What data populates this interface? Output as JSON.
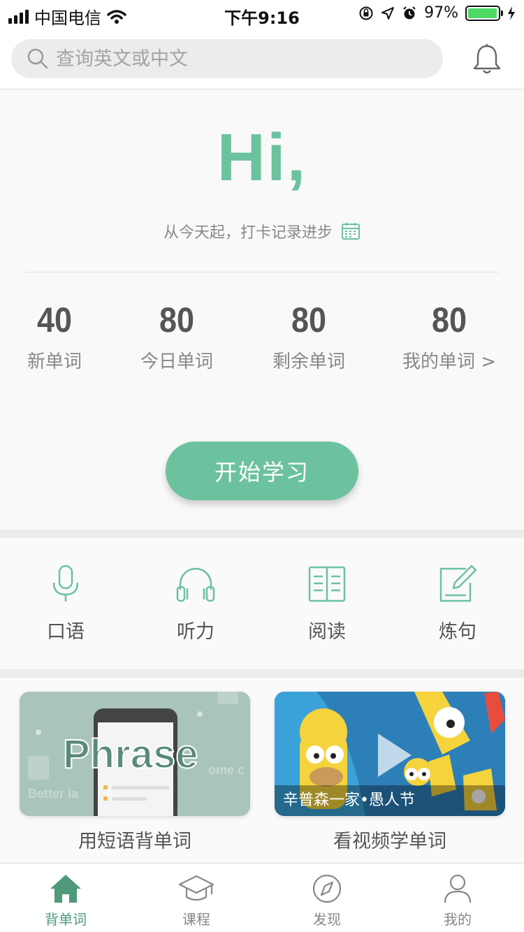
{
  "status_bar": {
    "carrier": "中国电信",
    "time": "下午9:16",
    "battery_percent": "97%",
    "battery_level": 0.97,
    "battery_color": "#4cd964"
  },
  "header": {
    "search_placeholder": "查询英文或中文",
    "bell_icon": "bell-icon"
  },
  "hero": {
    "greeting": "Hi,",
    "subtitle": "从今天起，打卡记录进步",
    "calendar_icon": "calendar-icon",
    "accent_color": "#6cc29e"
  },
  "stats": [
    {
      "value": "40",
      "label": "新单词"
    },
    {
      "value": "80",
      "label": "今日单词"
    },
    {
      "value": "80",
      "label": "剩余单词"
    },
    {
      "value": "80",
      "label": "我的单词 >"
    }
  ],
  "start_button": "开始学习",
  "features": [
    {
      "label": "口语",
      "icon": "microphone-icon"
    },
    {
      "label": "听力",
      "icon": "headphones-icon"
    },
    {
      "label": "阅读",
      "icon": "book-icon"
    },
    {
      "label": "炼句",
      "icon": "edit-note-icon"
    }
  ],
  "cards": [
    {
      "title": "用短语背单词",
      "image_text": "Phrase",
      "image_subtext": "Better la        er.",
      "image_subtext2": "ome c"
    },
    {
      "title": "看视频学单词",
      "caption": "辛普森一家•愚人节"
    }
  ],
  "tabs": [
    {
      "label": "背单词",
      "icon": "home-icon",
      "active": true
    },
    {
      "label": "课程",
      "icon": "graduation-cap-icon",
      "active": false
    },
    {
      "label": "发现",
      "icon": "compass-icon",
      "active": false
    },
    {
      "label": "我的",
      "icon": "user-icon",
      "active": false
    }
  ]
}
